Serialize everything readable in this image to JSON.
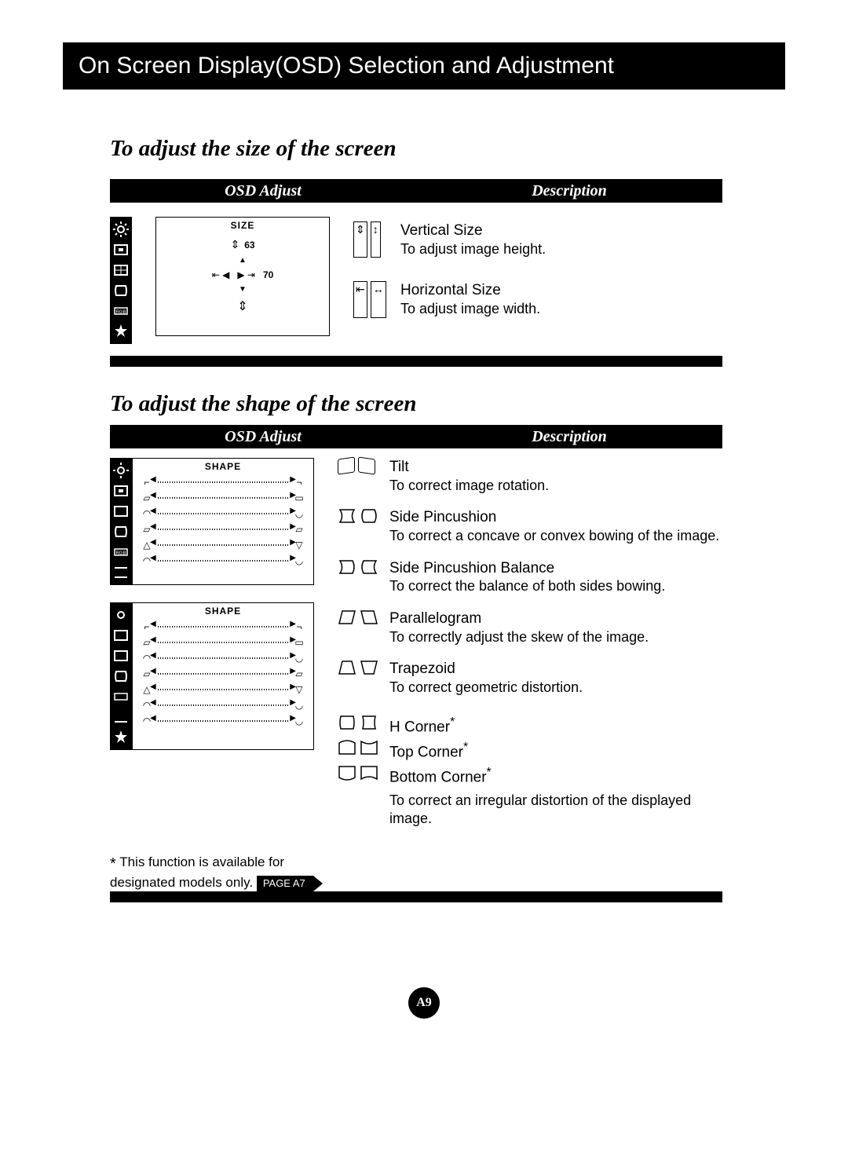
{
  "title": "On Screen Display(OSD) Selection and Adjustment",
  "section1": {
    "heading": "To adjust the size of the screen",
    "colL": "OSD Adjust",
    "colR": "Description",
    "osd_title": "SIZE",
    "val_v": "63",
    "val_h": "70",
    "desc": {
      "vs_title": "Vertical Size",
      "vs_body": "To adjust image height.",
      "hs_title": "Horizontal Size",
      "hs_body": "To adjust image width."
    }
  },
  "section2": {
    "heading": "To adjust the shape of the screen",
    "colL": "OSD Adjust",
    "colR": "Description",
    "osd_title1": "SHAPE",
    "osd_title2": "SHAPE",
    "desc": {
      "tilt_t": "Tilt",
      "tilt_b": "To correct image rotation.",
      "sp_t": "Side Pincushion",
      "sp_b": "To correct a concave or convex bowing of the image.",
      "spb_t": "Side Pincushion Balance",
      "spb_b": "To correct the balance of both sides bowing.",
      "par_t": "Parallelogram",
      "par_b": "To correctly adjust the skew of the image.",
      "trap_t": "Trapezoid",
      "trap_b": "To correct geometric distortion.",
      "hc_t": "H Corner",
      "tc_t": "Top Corner",
      "bc_t": "Bottom Corner",
      "corner_b": "To correct an irregular distortion of the displayed image."
    }
  },
  "footnote": {
    "star": "*",
    "text": " This function is available for designated models only. ",
    "page_ref": "PAGE A7"
  },
  "page_number": "A9"
}
